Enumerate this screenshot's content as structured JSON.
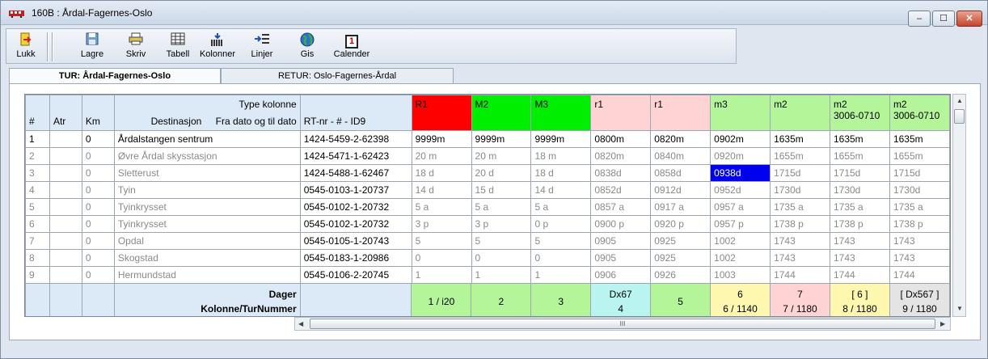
{
  "window": {
    "title": "160B   : Årdal-Fagernes-Oslo",
    "buttons": {
      "minimize": "–",
      "maximize": "☐",
      "close": "✕"
    }
  },
  "toolbar": {
    "lukk": "Lukk",
    "lagre": "Lagre",
    "skriv": "Skriv",
    "tabell": "Tabell",
    "kolonner": "Kolonner",
    "linjer": "Linjer",
    "gis": "Gis",
    "calender": "Calender",
    "calender_icon_text": "1"
  },
  "tabs": [
    "TUR: Årdal-Fagernes-Oslo",
    "RETUR: Oslo-Fagernes-Årdal"
  ],
  "grid": {
    "header": {
      "num": "#",
      "atr": "Atr",
      "km": "Km",
      "type_kolonne": "Type kolonne",
      "destinasjon": "Destinasjon",
      "fra_dato": "Fra dato og til dato",
      "rtnr": "RT-nr - # - ID9"
    },
    "columns": [
      {
        "code": "R1",
        "dates": "",
        "color": "#ff0000"
      },
      {
        "code": "M2",
        "dates": "",
        "color": "#00ee00"
      },
      {
        "code": "M3",
        "dates": "",
        "color": "#00ee00"
      },
      {
        "code": "r1",
        "dates": "",
        "color": "#ffd3d3"
      },
      {
        "code": "r1",
        "dates": "",
        "color": "#ffd3d3"
      },
      {
        "code": "m3",
        "dates": "",
        "color": "#b4f59a"
      },
      {
        "code": "m2",
        "dates": "",
        "color": "#b4f59a"
      },
      {
        "code": "m2",
        "dates": "3006-0710",
        "color": "#b4f59a"
      },
      {
        "code": "m2",
        "dates": "3006-0710",
        "color": "#b4f59a"
      }
    ],
    "rows": [
      {
        "num": "1",
        "km": "0",
        "name": "Årdalstangen sentrum",
        "id": "1424-5459-2-62398",
        "times": [
          "9999m",
          "9999m",
          "9999m",
          "0800m",
          "0820m",
          "0902m",
          "1635m",
          "1635m",
          "1635m"
        ]
      },
      {
        "num": "2",
        "km": "0",
        "name": "Øvre Årdal skysstasjon",
        "id": "1424-5471-1-62423",
        "times": [
          "20  m",
          "20  m",
          "18  m",
          "0820m",
          "0840m",
          "0920m",
          "1655m",
          "1655m",
          "1655m"
        ]
      },
      {
        "num": "3",
        "km": "0",
        "name": "Sletterust",
        "id": "1424-5488-1-62467",
        "times": [
          "18  d",
          "20  d",
          "18  d",
          "0838d",
          "0858d",
          "0938d",
          "1715d",
          "1715d",
          "1715d"
        ]
      },
      {
        "num": "4",
        "km": "0",
        "name": "Tyin",
        "id": "0545-0103-1-20737",
        "times": [
          "14  d",
          "15  d",
          "14  d",
          "0852d",
          "0912d",
          "0952d",
          "1730d",
          "1730d",
          "1730d"
        ]
      },
      {
        "num": "5",
        "km": "0",
        "name": "Tyinkrysset",
        "id": "0545-0102-1-20732",
        "times": [
          "5    a",
          "5    a",
          "5    a",
          "0857 a",
          "0917 a",
          "0957 a",
          "1735 a",
          "1735 a",
          "1735 a"
        ]
      },
      {
        "num": "6",
        "km": "0",
        "name": "Tyinkrysset",
        "id": "0545-0102-1-20732",
        "times": [
          "3    p",
          "3    p",
          "0    p",
          "0900 p",
          "0920 p",
          "0957 p",
          "1738 p",
          "1738 p",
          "1738 p"
        ]
      },
      {
        "num": "7",
        "km": "0",
        "name": "Opdal",
        "id": "0545-0105-1-20743",
        "times": [
          "5",
          "5",
          "5",
          "0905",
          "0925",
          "1002",
          "1743",
          "1743",
          "1743"
        ]
      },
      {
        "num": "8",
        "km": "0",
        "name": "Skogstad",
        "id": "0545-0183-1-20986",
        "times": [
          "0",
          "0",
          "0",
          "0905",
          "0925",
          "1002",
          "1743",
          "1743",
          "1743"
        ]
      },
      {
        "num": "9",
        "km": "0",
        "name": "Hermundstad",
        "id": "0545-0106-2-20745",
        "times": [
          "1",
          "1",
          "1",
          "0906",
          "0926",
          "1003",
          "1744",
          "1744",
          "1744"
        ]
      }
    ],
    "footer": {
      "dager_label": "Dager",
      "kolonne_label": "Kolonne/TurNummer",
      "cols": [
        {
          "dager": "",
          "tur": "1 / i20",
          "color": "#b4f59a"
        },
        {
          "dager": "",
          "tur": "2",
          "color": "#b4f59a"
        },
        {
          "dager": "",
          "tur": "3",
          "color": "#b4f59a"
        },
        {
          "dager": "Dx67",
          "tur": "4",
          "color": "#b9f4f0"
        },
        {
          "dager": "",
          "tur": "5",
          "color": "#b4f59a"
        },
        {
          "dager": "6",
          "tur": "6 / 1140",
          "color": "#fdf7b0"
        },
        {
          "dager": "7",
          "tur": "7 / 1180",
          "color": "#ffd3d3"
        },
        {
          "dager": "[ 6 ]",
          "tur": "8 / 1180",
          "color": "#fdf7b0"
        },
        {
          "dager": "[ Dx567 ]",
          "tur": "9 / 1180",
          "color": "#e4e4e4"
        }
      ]
    },
    "scroll": {
      "arrow_up": "▲",
      "arrow_down": "▼",
      "arrow_left": "◀",
      "arrow_right": "▶",
      "grip": "III"
    }
  }
}
